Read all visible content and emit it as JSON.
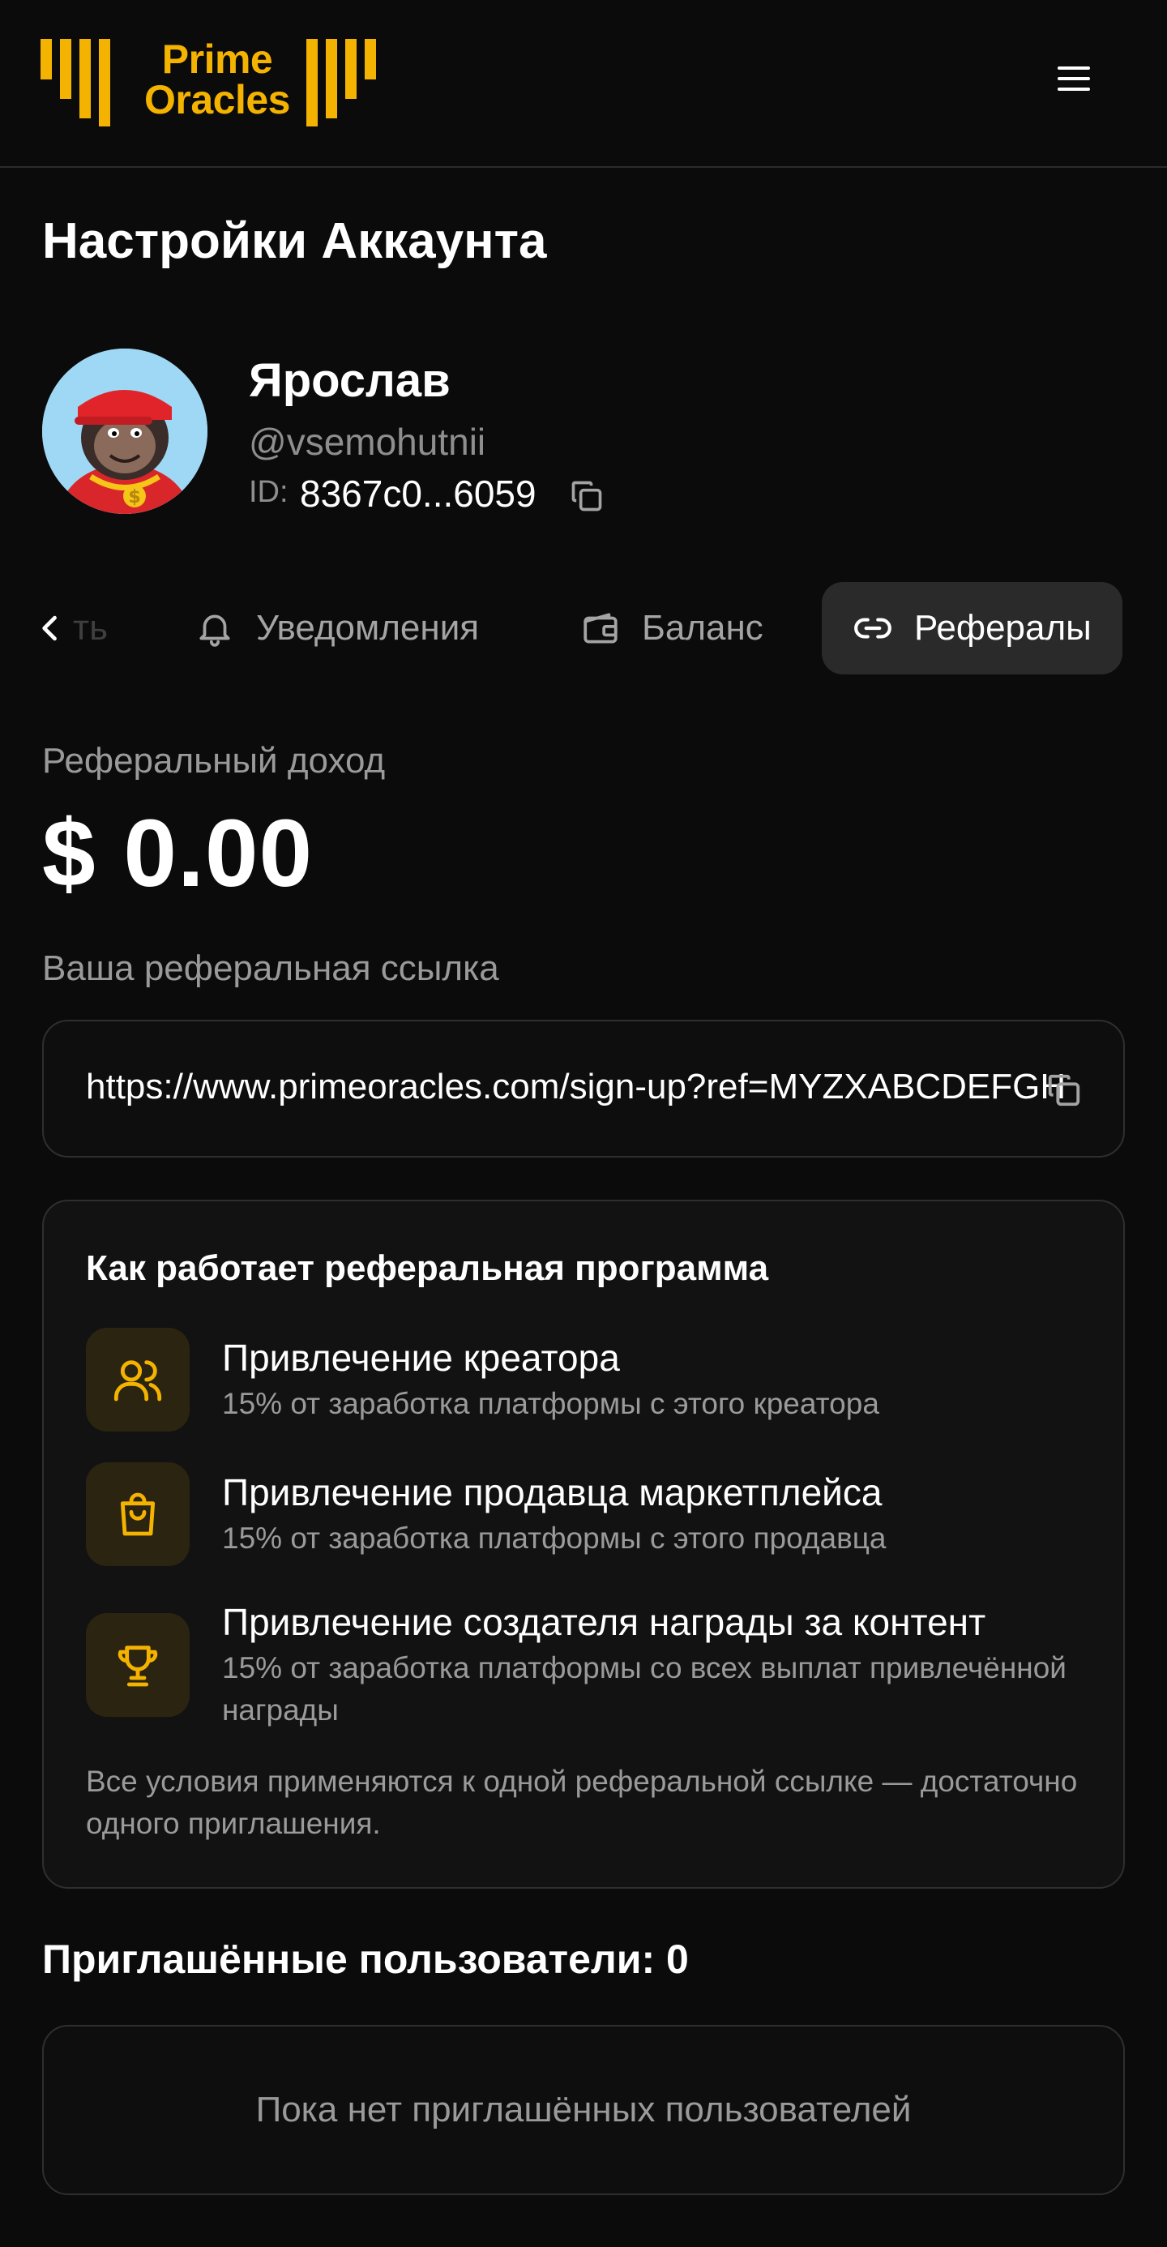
{
  "header": {
    "logo_line1": "Prime",
    "logo_line2": "Oracles",
    "menu_icon": "hamburger-menu-icon"
  },
  "page": {
    "title": "Настройки Аккаунта"
  },
  "profile": {
    "name": "Ярослав",
    "handle": "@vsemohutnii",
    "id_label": "ID:",
    "id_value": "8367c0...6059",
    "avatar": "gorilla-avatar"
  },
  "tabs": {
    "prev_partial": "ть",
    "items": [
      {
        "label": "Уведомления",
        "icon": "bell-icon",
        "active": false
      },
      {
        "label": "Баланс",
        "icon": "wallet-icon",
        "active": false
      },
      {
        "label": "Рефералы",
        "icon": "link-icon",
        "active": true
      }
    ]
  },
  "referral": {
    "income_label": "Реферальный доход",
    "income_value": "$ 0.00",
    "link_label": "Ваша реферальная ссылка",
    "link_value": "https://www.primeoracles.com/sign-up?ref=MYZXABCDEFGH"
  },
  "howto": {
    "title": "Как работает реферальная программа",
    "items": [
      {
        "icon": "users-icon",
        "title": "Привлечение креатора",
        "desc": "15% от заработка платформы с этого креатора"
      },
      {
        "icon": "shopping-bag-icon",
        "title": "Привлечение продавца маркетплейса",
        "desc": "15% от заработка платформы с этого продавца"
      },
      {
        "icon": "trophy-icon",
        "title": "Привлечение создателя награды за контент",
        "desc": "15% от заработка платформы со всех выплат привлечённой награды"
      }
    ],
    "note": "Все условия применяются к одной реферальной ссылке — достаточно одного приглашения."
  },
  "invited": {
    "title": "Приглашённые пользователи: 0",
    "empty_text": "Пока нет приглашённых пользователей"
  },
  "colors": {
    "accent": "#f5b301",
    "background": "#0b0b0b",
    "card": "#121212",
    "border": "#2f2f2f"
  }
}
